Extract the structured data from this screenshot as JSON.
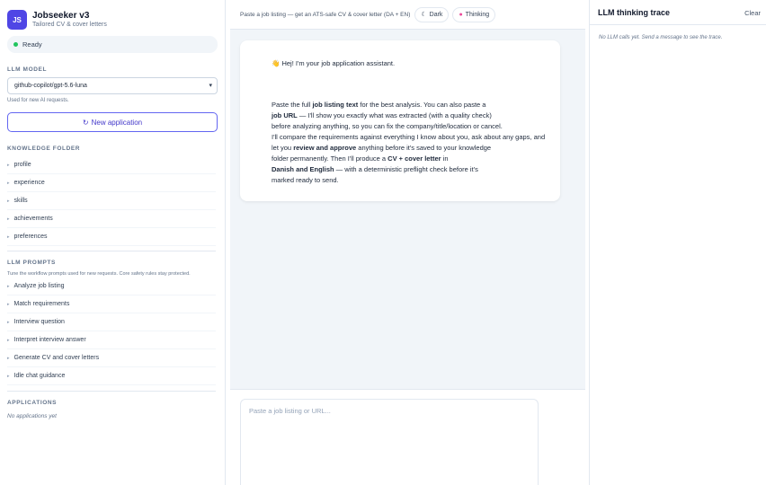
{
  "brand": {
    "logo": "JS",
    "title": "Jobseeker v3",
    "subtitle": "Tailored CV & cover letters"
  },
  "status": {
    "label": "Ready",
    "color": "#22c55e"
  },
  "model": {
    "section_label": "LLM MODEL",
    "selected": "github-copilot/gpt-5.6-luna",
    "hint": "Used for new AI requests."
  },
  "new_app_button": {
    "label": "New application",
    "icon": "refresh-icon"
  },
  "knowledge": {
    "section_label": "KNOWLEDGE FOLDER",
    "items": [
      "profile",
      "experience",
      "skills",
      "achievements",
      "preferences"
    ]
  },
  "prompts": {
    "section_label": "LLM PROMPTS",
    "hint": "Tune the workflow prompts used for new requests. Core safety rules stay protected.",
    "items": [
      "Analyze job listing",
      "Match requirements",
      "Interview question",
      "Interpret interview answer",
      "Generate CV and cover letters",
      "Idle chat guidance"
    ]
  },
  "applications": {
    "section_label": "APPLICATIONS",
    "empty": "No applications yet"
  },
  "topbar": {
    "description": "Paste a job listing — get an ATS-safe CV & cover letter (DA + EN)",
    "dark_label": "Dark",
    "dark_icon": "moon-icon",
    "thinking_label": "Thinking",
    "thinking_icon": "brain-icon"
  },
  "chat": {
    "greeting_icon": "wave-hand-icon",
    "greeting": "Hej! I'm your job application assistant.",
    "body": {
      "t1": "Paste the full ",
      "b1": "job listing text",
      "t2": " for the best analysis. You can also paste a",
      "b2": "job URL",
      "t3": " — I'll show you exactly what was extracted (with a quality check)",
      "t4": "before analyzing anything, so you can fix the company/title/location or cancel.",
      "t5": "I'll compare the requirements against everything I know about you, ask about any gaps, and",
      "t6": "let you ",
      "b3": "review and approve",
      "t7": " anything before it's saved to your knowledge",
      "t8": "folder permanently. Then I'll produce a ",
      "b4": "CV + cover letter",
      "t9": " in",
      "b5": "Danish and English",
      "t10": " — with a deterministic preflight check before it's",
      "t11": "marked ready to send."
    }
  },
  "composer": {
    "placeholder": "Paste a job listing or URL..."
  },
  "trace": {
    "title": "LLM thinking trace",
    "clear_label": "Clear",
    "empty": "No LLM calls yet. Send a message to see the trace."
  },
  "colors": {
    "accent": "#4f46e5",
    "accent_border": "#6366f1"
  }
}
